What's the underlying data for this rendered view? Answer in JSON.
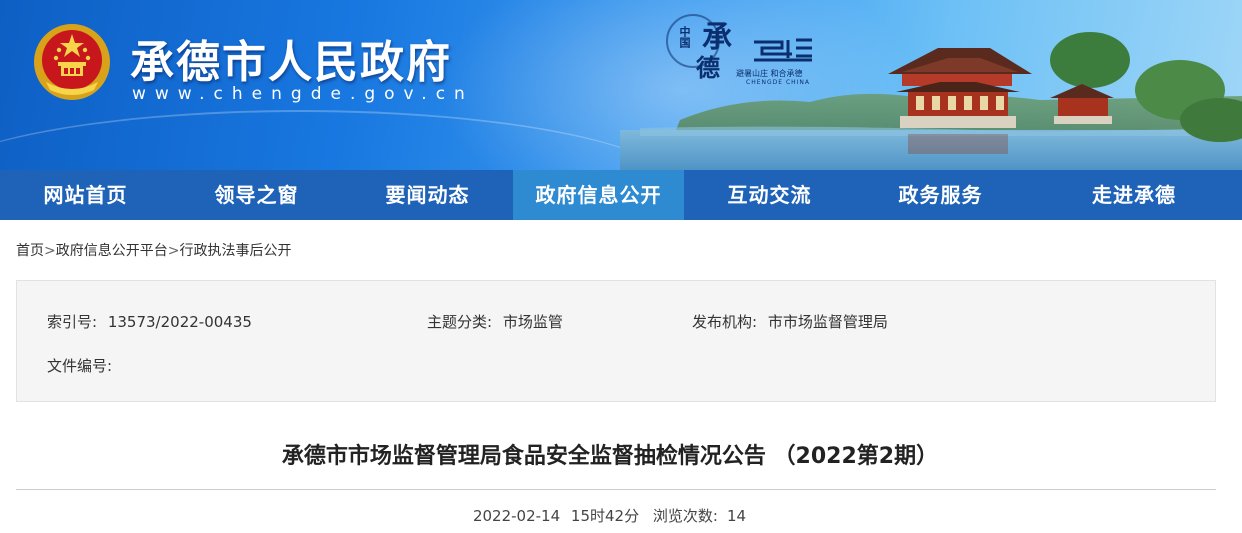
{
  "header": {
    "site_title": "承德市人民政府",
    "site_url": "www.chengde.gov.cn",
    "city_logo": {
      "prefix": "中国",
      "char1": "承",
      "char2": "德",
      "slogan": "避暑山庄 和合承德",
      "sub": "CHENGDE CHINA"
    }
  },
  "nav": {
    "items": [
      {
        "label": "网站首页"
      },
      {
        "label": "领导之窗"
      },
      {
        "label": "要闻动态"
      },
      {
        "label": "政府信息公开"
      },
      {
        "label": "互动交流"
      },
      {
        "label": "政务服务"
      },
      {
        "label": "走进承德"
      }
    ],
    "active_index": 3
  },
  "breadcrumb": {
    "items": [
      "首页",
      "政府信息公开平台",
      "行政执法事后公开"
    ],
    "separator": ">"
  },
  "meta": {
    "index_label": "索引号:",
    "index_value": "13573/2022-00435",
    "topic_label": "主题分类:",
    "topic_value": "市场监管",
    "publisher_label": "发布机构:",
    "publisher_value": "市市场监督管理局",
    "docno_label": "文件编号:",
    "docno_value": ""
  },
  "article": {
    "title": "承德市市场监督管理局食品安全监督抽检情况公告 （2022第2期）",
    "date": "2022-02-14",
    "time": "15时42分",
    "views_label": "浏览次数:",
    "views_value": "14"
  },
  "colors": {
    "nav_bg": "#1f63b8",
    "nav_active": "#2e8ad1",
    "banner_start": "#0e5fc4",
    "meta_bg": "#f5f5f5"
  }
}
